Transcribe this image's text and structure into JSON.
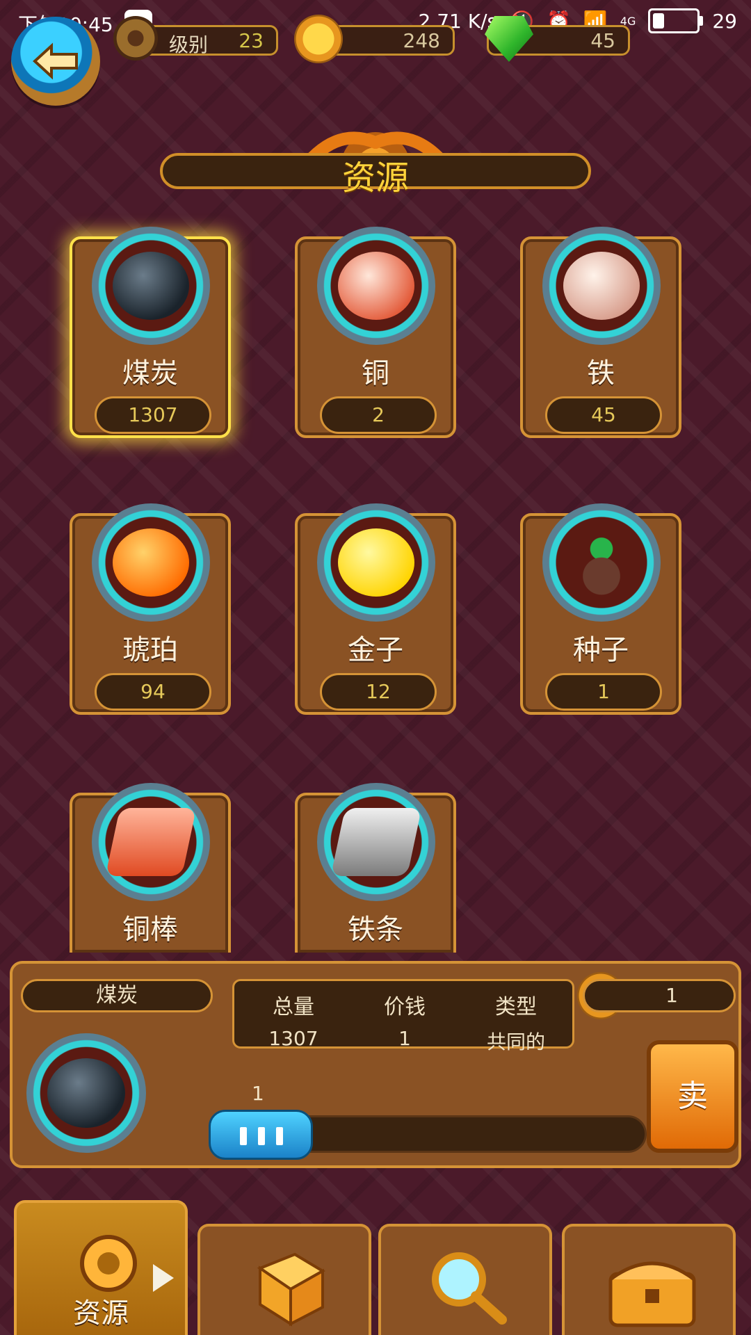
{
  "status_bar": {
    "time": "下午10:45",
    "net_speed": "2.71 K/s",
    "network": "4G",
    "battery": "29",
    "battery_level": 0.29
  },
  "hud": {
    "level_label": "级别",
    "level_value": "23",
    "coins": "248",
    "gems": "45"
  },
  "title": "资源",
  "resources": [
    {
      "name": "煤炭",
      "count": "1307",
      "icon": "coal",
      "selected": true
    },
    {
      "name": "铜",
      "count": "2",
      "icon": "copper-ore"
    },
    {
      "name": "铁",
      "count": "45",
      "icon": "iron-ore"
    },
    {
      "name": "琥珀",
      "count": "94",
      "icon": "amber"
    },
    {
      "name": "金子",
      "count": "12",
      "icon": "gold"
    },
    {
      "name": "种子",
      "count": "1",
      "icon": "seed"
    },
    {
      "name": "铜棒",
      "icon": "copper-bar"
    },
    {
      "name": "铁条",
      "icon": "iron-bar"
    }
  ],
  "detail": {
    "name": "煤炭",
    "total_label": "总量",
    "total_value": "1307",
    "price_label": "价钱",
    "price_value": "1",
    "type_label": "类型",
    "type_value": "共同的",
    "sell_price": "1",
    "slider_value": "1",
    "sell_label": "卖"
  },
  "tabs": [
    {
      "label": "资源",
      "icon": "gear-icon",
      "active": true
    },
    {
      "label": "",
      "icon": "dice-icon"
    },
    {
      "label": "",
      "icon": "magnifier-icon"
    },
    {
      "label": "",
      "icon": "treasure-chest-icon"
    }
  ]
}
